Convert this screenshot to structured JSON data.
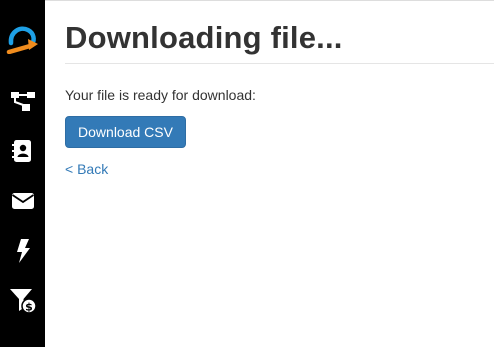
{
  "sidebar": {
    "items": [
      {
        "icon": "logo-icon"
      },
      {
        "icon": "sitemap-icon"
      },
      {
        "icon": "contacts-book-icon"
      },
      {
        "icon": "envelope-icon"
      },
      {
        "icon": "lightning-bolt-icon"
      },
      {
        "icon": "funnel-dollar-icon"
      }
    ],
    "background": "#000000"
  },
  "main": {
    "title": "Downloading file...",
    "message": "Your file is ready for download:",
    "download_button_label": "Download CSV",
    "back_link_label": "< Back"
  },
  "colors": {
    "primary_button": "#337ab7",
    "link": "#337ab7",
    "logo_blue": "#1ea0e6",
    "logo_orange": "#f08c1e",
    "text": "#333333"
  }
}
